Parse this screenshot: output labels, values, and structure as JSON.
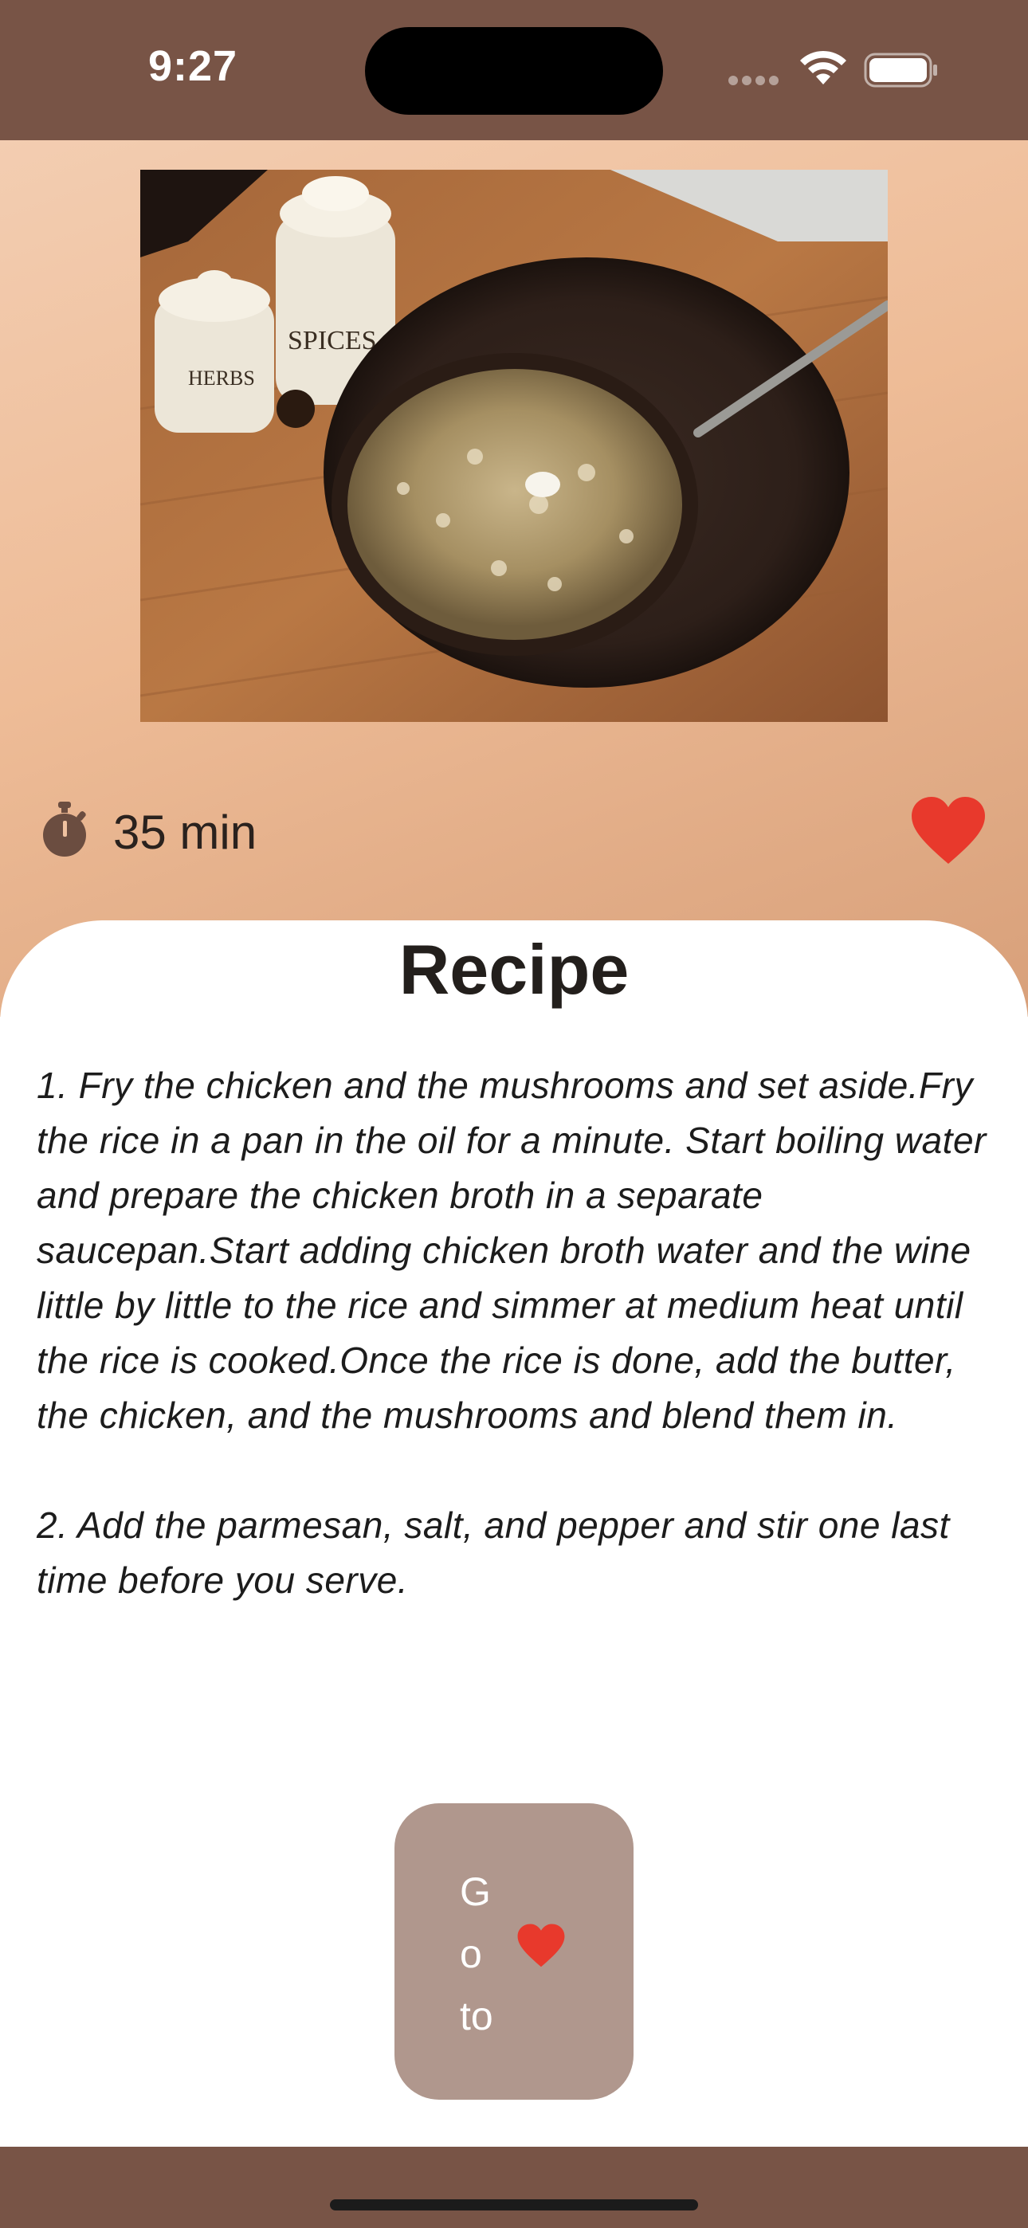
{
  "status_bar": {
    "time": "9:27"
  },
  "recipe": {
    "photo_icon": "food-photo",
    "cook_time": "35 min",
    "title": "Recipe",
    "steps": [
      "1. Fry the chicken and the mushrooms and set aside.Fry the rice in a pan in the oil for a minute. Start boiling water and prepare the chicken broth in a separate saucepan.Start adding chicken broth water and the wine little by little to the rice and simmer at medium heat until the rice is cooked.Once the rice is done, add the butter, the chicken, and the mushrooms and blend them in.",
      "2. Add the parmesan, salt, and pepper and stir one last time before you serve."
    ],
    "favorite_state": "favorited"
  },
  "goto_button": {
    "label_lines": [
      "G",
      "o",
      "to"
    ],
    "icon": "heart-icon"
  },
  "colors": {
    "bar_brown": "#785446",
    "heart_red": "#e8392c",
    "button_bg": "#b0978d",
    "hero_gradient_start": "#f3cdb1",
    "hero_gradient_end": "#d8a07a"
  }
}
